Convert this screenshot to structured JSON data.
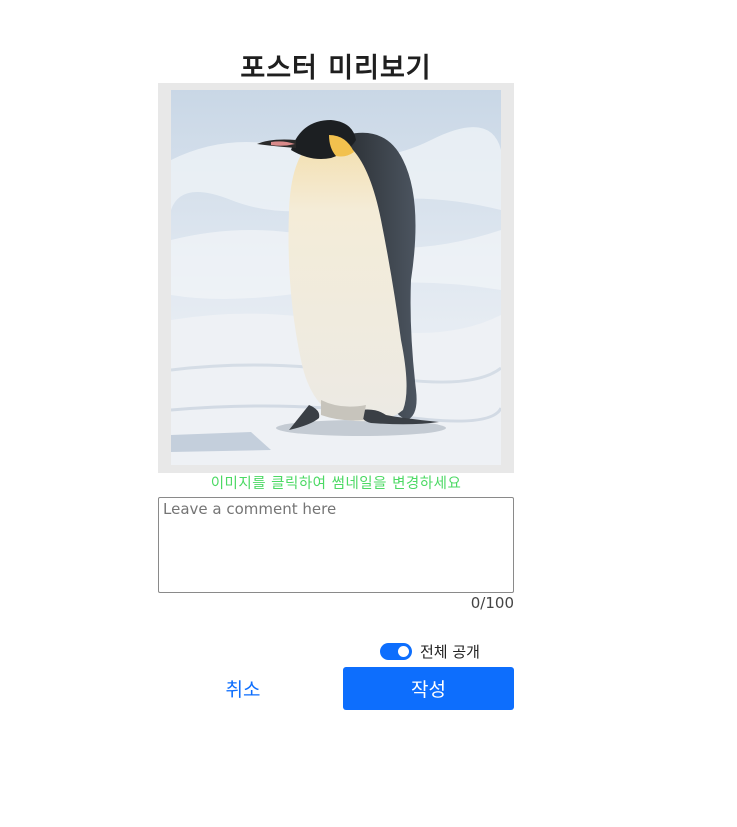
{
  "header": {
    "title": "포스터 미리보기"
  },
  "thumbnail": {
    "subject": "penguin",
    "hint": "이미지를 클릭하여 썸네일을 변경하세요"
  },
  "comment": {
    "placeholder": "Leave a comment here",
    "value": "",
    "counter": "0/100"
  },
  "visibility": {
    "label": "전체 공개",
    "enabled": true
  },
  "actions": {
    "cancel_label": "취소",
    "submit_label": "작성"
  },
  "colors": {
    "accent": "#0d6efd",
    "hint": "#4cd964"
  }
}
